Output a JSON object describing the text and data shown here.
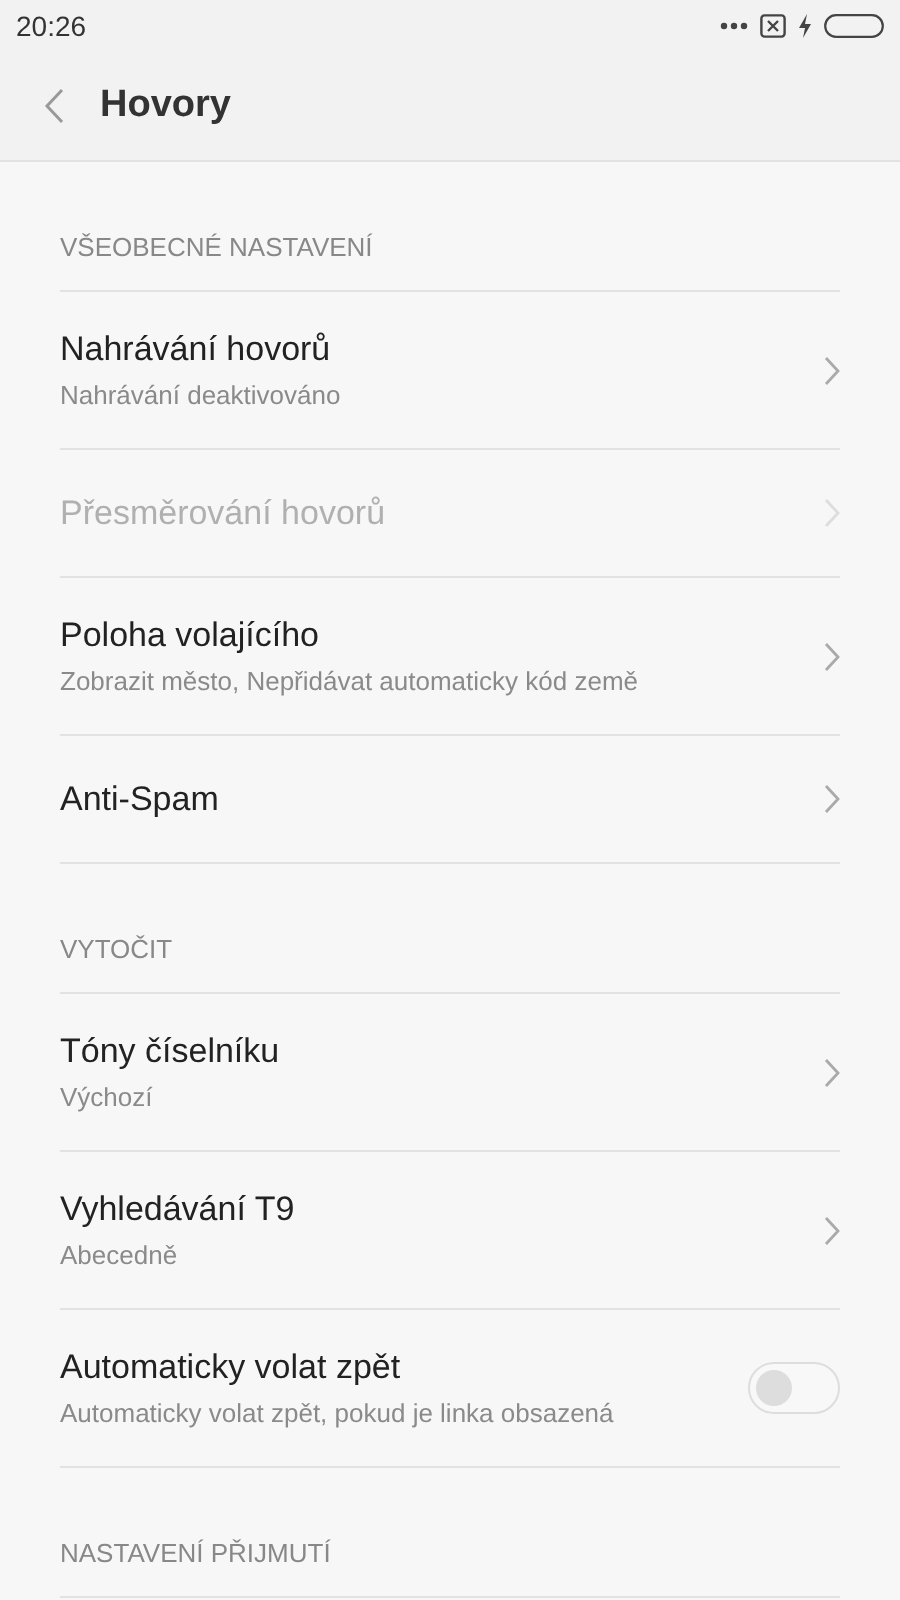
{
  "status_bar": {
    "time": "20:26"
  },
  "header": {
    "title": "Hovory"
  },
  "sections": [
    {
      "title": "VŠEOBECNÉ NASTAVENÍ",
      "items": [
        {
          "kind": "link",
          "label": "Nahrávání hovorů",
          "summary": "Nahrávání deaktivováno",
          "disabled": false
        },
        {
          "kind": "link",
          "label": "Přesměrování hovorů",
          "disabled": true
        },
        {
          "kind": "link",
          "label": "Poloha volajícího",
          "summary": "Zobrazit město, Nepřidávat automaticky kód země",
          "disabled": false
        },
        {
          "kind": "link",
          "label": "Anti-Spam",
          "disabled": false
        }
      ]
    },
    {
      "title": "VYTOČIT",
      "items": [
        {
          "kind": "link",
          "label": "Tóny číselníku",
          "summary": "Výchozí",
          "disabled": false
        },
        {
          "kind": "link",
          "label": "Vyhledávání T9",
          "summary": "Abecedně",
          "disabled": false
        },
        {
          "kind": "toggle",
          "label": "Automaticky volat zpět",
          "summary": "Automaticky volat zpět, pokud je linka obsazená",
          "disabled": false,
          "on": false
        }
      ]
    },
    {
      "title": "NASTAVENÍ PŘIJMUTÍ"
    }
  ]
}
